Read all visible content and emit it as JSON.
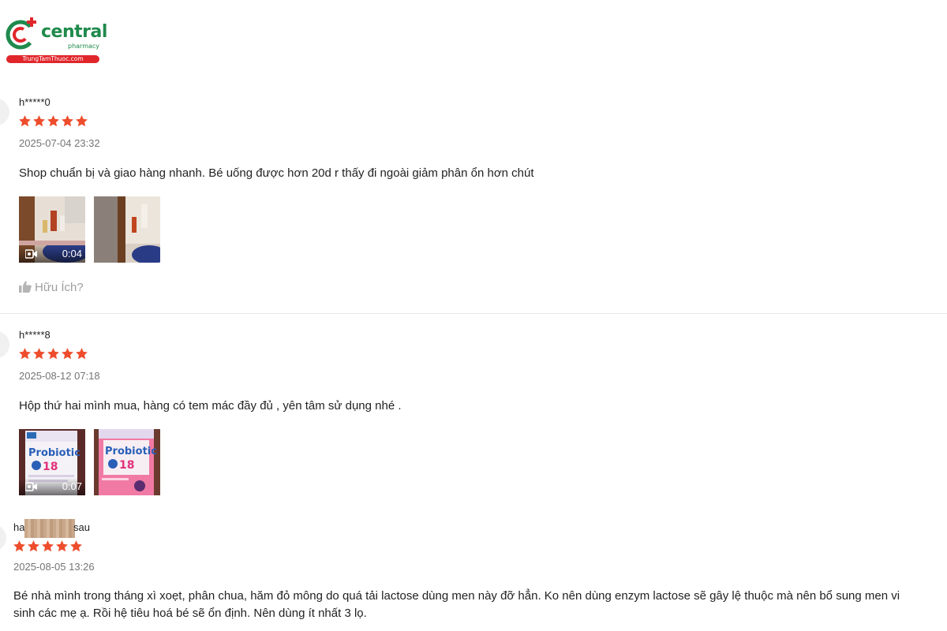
{
  "logo": {
    "brand": "central",
    "sub": "pharmacy",
    "tagline": "TrungTamThuoc.com",
    "colors": {
      "green": "#1f8a4c",
      "red": "#e0262b"
    }
  },
  "star_color": "#ee4d2d",
  "reviews": [
    {
      "username": "h*****0",
      "rating": 5,
      "date": "2025-07-04 23:32",
      "comment": "Shop chuẩn bị và giao hàng nhanh. Bé uống được hơn 20d r thấy đi ngoài giảm phân ổn hơn chút",
      "media": [
        {
          "type": "video",
          "duration": "0:04",
          "icon": "video-camera-icon"
        },
        {
          "type": "image"
        }
      ],
      "helpful_label": "Hữu Ích?"
    },
    {
      "username": "h*****8",
      "rating": 5,
      "date": "2025-08-12 07:18",
      "comment": "Hộp thứ hai mình mua, hàng có tem mác đầy đủ , yên tâm sử dụng nhé .",
      "media": [
        {
          "type": "video",
          "duration": "0:07",
          "icon": "video-camera-icon",
          "product_text": "Probiotic",
          "product_num": "18"
        },
        {
          "type": "image",
          "product_text": "Probiotic",
          "product_num": "18"
        }
      ]
    },
    {
      "username_prefix": "ha",
      "username_suffix": "sau",
      "rating": 5,
      "date": "2025-08-05 13:26",
      "comment_line1": "Bé nhà mình trong tháng xì xoẹt, phân chua, hăm đỏ mông do quá tải lactose dùng men này đỡ hẳn. Ko nên dùng enzym lactose sẽ gây lệ thuộc mà nên bổ sung men vi",
      "comment_line2": "sinh các mẹ ạ. Rồi hệ tiêu hoá bé sẽ ổn định. Nên dùng ít nhất 3 lọ."
    }
  ]
}
